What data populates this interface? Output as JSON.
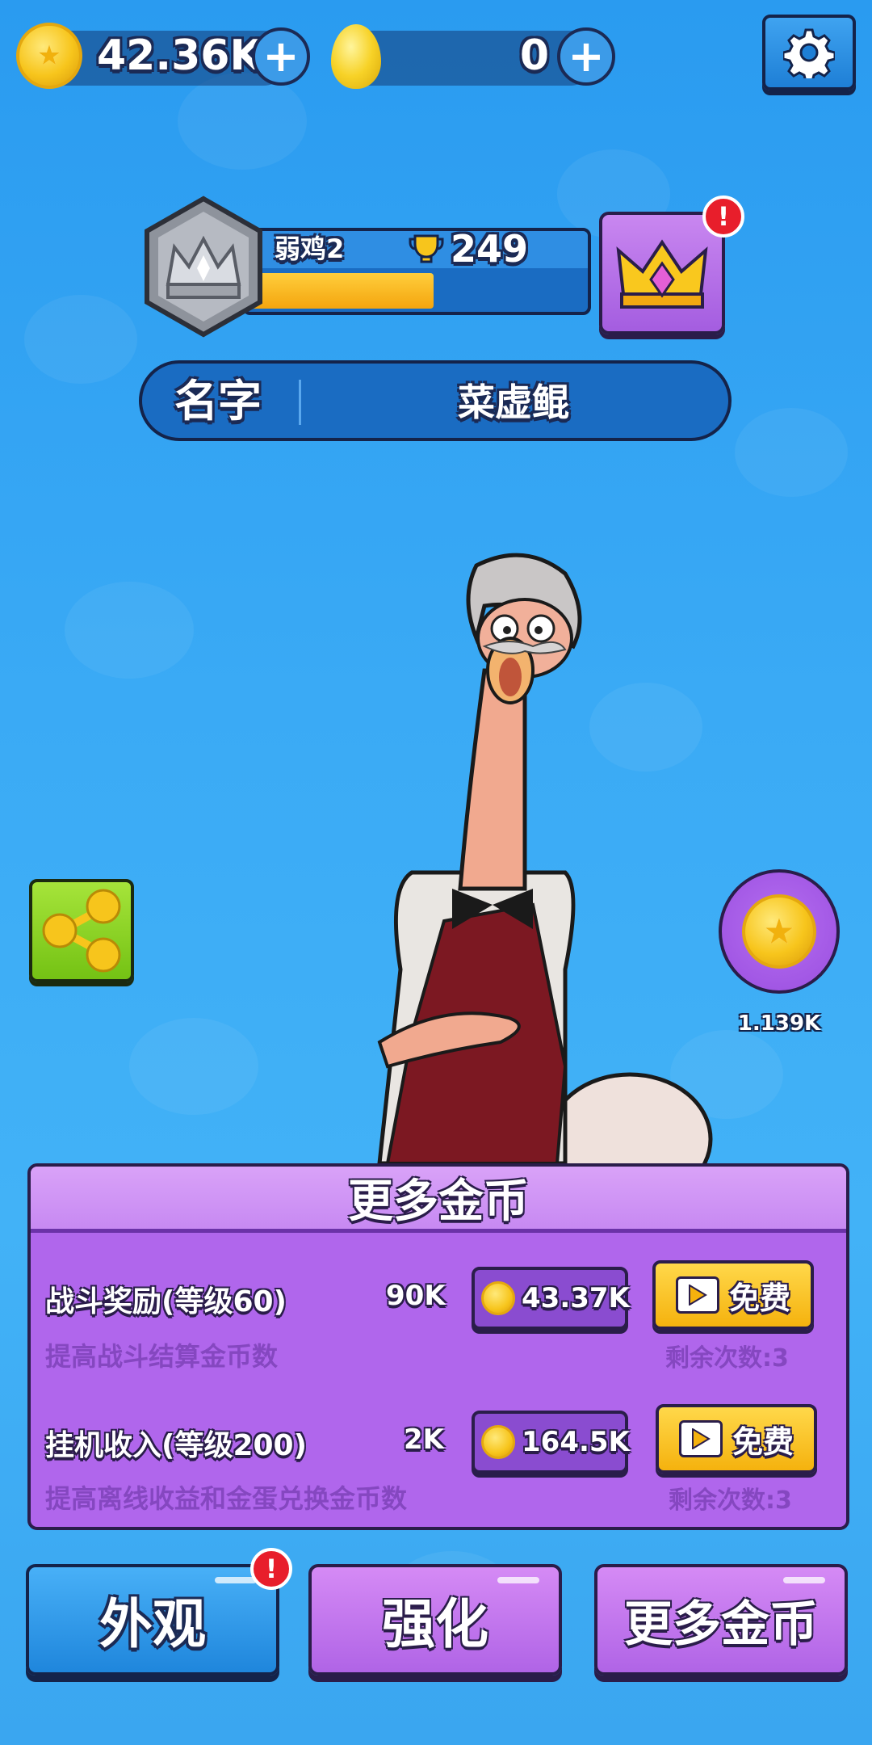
{
  "currency": {
    "coins": "42.36K",
    "eggs": "0"
  },
  "rank": {
    "title": "弱鸡2",
    "trophies": "249",
    "progress": 0.55
  },
  "name": {
    "label": "名字",
    "value": "菜虚鲲"
  },
  "side": {
    "coin_bubble_value": "1.139K"
  },
  "panel": {
    "title": "更多金币",
    "rows": [
      {
        "title": "战斗奖励(等级60)",
        "value": "90K",
        "cost": "43.37K",
        "free_label": "免费",
        "subtitle": "提高战斗结算金币数",
        "remaining": "剩余次数:3"
      },
      {
        "title": "挂机收入(等级200)",
        "value": "2K",
        "cost": "164.5K",
        "free_label": "免费",
        "subtitle": "提高离线收益和金蛋兑换金币数",
        "remaining": "剩余次数:3"
      }
    ]
  },
  "nav": {
    "appearance": "外观",
    "upgrade": "强化",
    "more_coins": "更多金币"
  },
  "alerts": {
    "mark": "!"
  },
  "icons": [
    "coin-icon",
    "plus-icon",
    "egg-icon",
    "gear-icon",
    "rank-badge-icon",
    "trophy-icon",
    "crown-icon",
    "share-icon",
    "play-icon"
  ],
  "colors": {
    "background": "#3aaaf5",
    "panel": "#b066ec",
    "free_button": "#f5b20e",
    "nav_blue": "#1f86dc",
    "nav_purple": "#b064e6"
  }
}
